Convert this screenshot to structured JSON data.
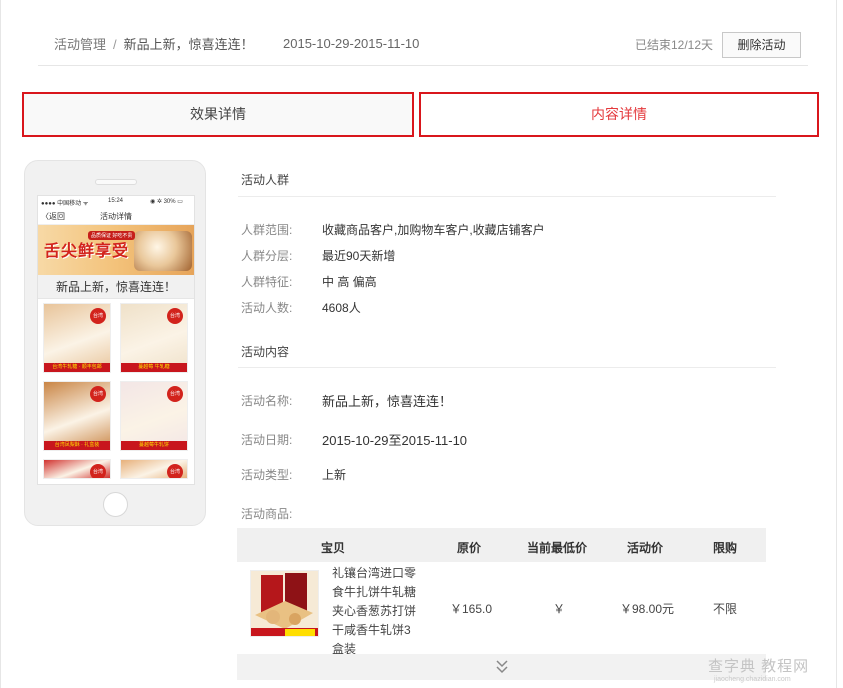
{
  "header": {
    "breadcrumb_root": "活动管理",
    "breadcrumb_sep": "/",
    "breadcrumb_current": "新品上新，惊喜连连！",
    "date_range": "2015-10-29-2015-11-10",
    "status": "已结束12/12天",
    "delete_label": "删除活动"
  },
  "tabs": [
    {
      "label": "效果详情",
      "active": false
    },
    {
      "label": "内容详情",
      "active": true
    }
  ],
  "phone": {
    "status_carrier": "●●●● 中国移动 ᯤ",
    "status_time": "15:24",
    "status_battery": "◉ ✲ 30% ▭",
    "nav_back": "〈返回",
    "nav_title": "活动详情",
    "banner_title": "舌尖鲜享受",
    "banner_sub": "品质保证 好吃不贵",
    "title": "新品上新，惊喜连连！",
    "tiles": [
      {
        "badge": "台湾",
        "strip": "台湾牛轧糖 · 顺丰包邮",
        "color": "#e8c49a"
      },
      {
        "badge": "台湾",
        "strip": "蔓越莓 牛轧糖",
        "color": "#efe1c9"
      },
      {
        "badge": "台湾",
        "strip": "台湾凤梨酥 · 礼盒装",
        "color": "#c98545"
      },
      {
        "badge": "台湾",
        "strip": "蔓越莓牛轧饼",
        "color": "#f3e6e6"
      },
      {
        "badge": "台湾",
        "strip": "",
        "color": "#d1322f"
      },
      {
        "badge": "台湾",
        "strip": "",
        "color": "#e7b07a"
      }
    ]
  },
  "audience": {
    "section_title": "活动人群",
    "rows": [
      {
        "label": "人群范围:",
        "value": "收藏商品客户,加购物车客户,收藏店铺客户"
      },
      {
        "label": "人群分层:",
        "value": "最近90天新增"
      },
      {
        "label": "人群特征:",
        "value": "中 高 偏高"
      },
      {
        "label": "活动人数:",
        "value": "4608人"
      }
    ]
  },
  "content": {
    "section_title": "活动内容",
    "rows": [
      {
        "label": "活动名称:",
        "value": "新品上新，惊喜连连！"
      },
      {
        "label": "活动日期:",
        "value": "2015-10-29至2015-11-10"
      },
      {
        "label": "活动类型:",
        "value": "上新"
      },
      {
        "label": "活动商品:",
        "value": ""
      }
    ]
  },
  "products": {
    "columns": [
      "宝贝",
      "原价",
      "当前最低价",
      "活动价",
      "限购"
    ],
    "rows": [
      {
        "name": "礼镶台湾进口零食牛扎饼牛轧糖夹心香葱苏打饼干咸香牛轧饼3盒装",
        "original_price": "￥165.0",
        "lowest_price": "￥",
        "activity_price": "￥98.00元",
        "limit": "不限"
      }
    ],
    "more_icon": "chevrons-down"
  },
  "watermark": {
    "main": "查字典 教程网",
    "sub": "jiaocheng.chazidian.com"
  },
  "colors": {
    "accent_red": "#d9161c",
    "active_tab_text": "#e4393c"
  }
}
